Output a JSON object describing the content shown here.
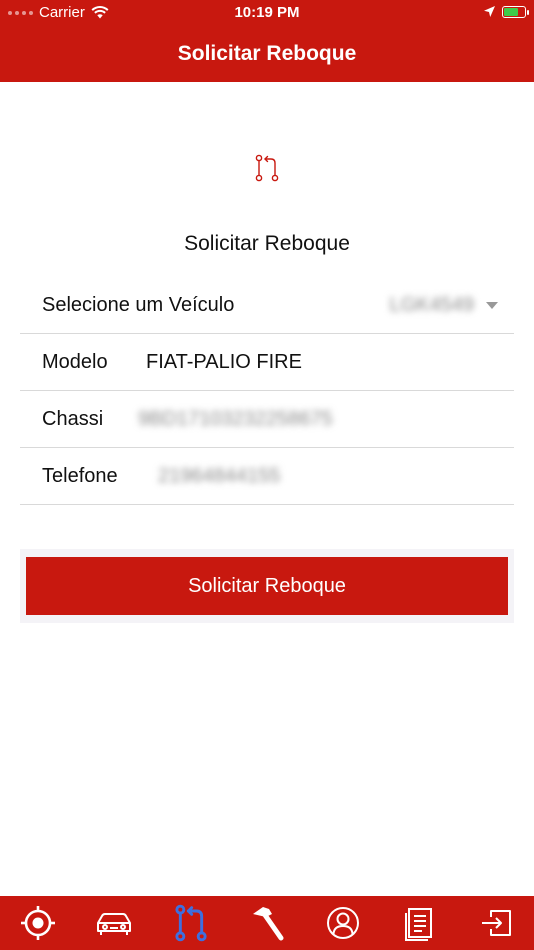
{
  "status_bar": {
    "carrier": "Carrier",
    "time": "10:19 PM"
  },
  "nav": {
    "title": "Solicitar Reboque"
  },
  "content": {
    "icon": "tow-request-icon",
    "title": "Solicitar Reboque",
    "vehicle_select": {
      "label": "Selecione um Veículo",
      "selected_value": "LGK4549"
    },
    "model": {
      "label": "Modelo",
      "value": "FIAT-PALIO FIRE"
    },
    "chassis": {
      "label": "Chassi",
      "value": "9BD17103232258675"
    },
    "phone": {
      "label": "Telefone",
      "value": "21964844155"
    },
    "submit_label": "Solicitar Reboque"
  },
  "tabbar": {
    "items": [
      {
        "icon": "location-target-icon",
        "active": false
      },
      {
        "icon": "car-icon",
        "active": false
      },
      {
        "icon": "tow-request-icon",
        "active": true
      },
      {
        "icon": "hammer-icon",
        "active": false
      },
      {
        "icon": "user-icon",
        "active": false
      },
      {
        "icon": "document-icon",
        "active": false
      },
      {
        "icon": "logout-icon",
        "active": false
      }
    ]
  },
  "colors": {
    "brand": "#c8180f",
    "tab_active": "#3d6fe0",
    "tab_inactive": "#ffffff"
  }
}
